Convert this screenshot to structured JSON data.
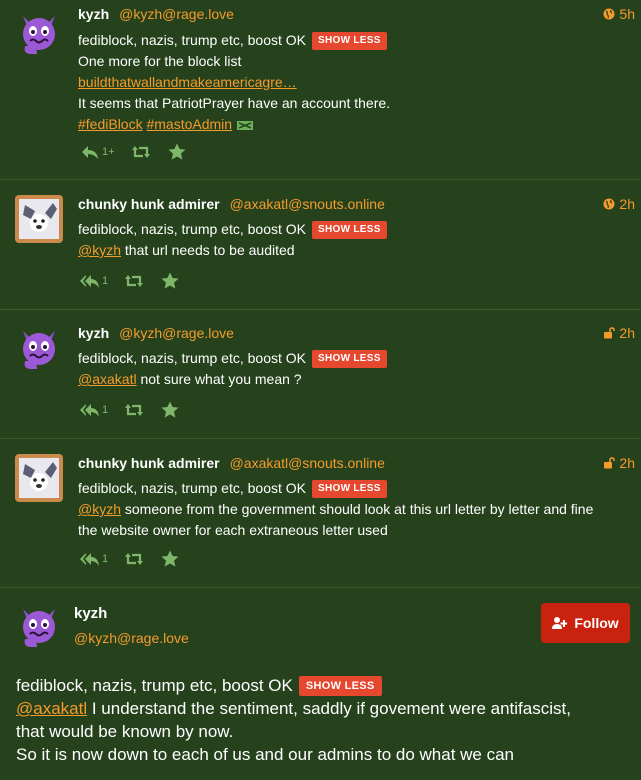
{
  "statuses": [
    {
      "display_name": "kyzh",
      "acct": "@kyzh@rage.love",
      "time": "5h",
      "visibility_icon": "globe-icon",
      "cw": "fediblock, nazis, trump etc, boost OK",
      "cw_button": "Show less",
      "lines": [
        "One more for the block list"
      ],
      "link": "buildthatwallandmakeamericagre…",
      "line2": "It seems that PatriotPrayer have an account there.",
      "hashtags": [
        "#fediBlock",
        "#mastoAdmin"
      ],
      "reply_count": "1+"
    },
    {
      "display_name": "chunky hunk admirer",
      "acct": "@axakatl@snouts.online",
      "time": "2h",
      "visibility_icon": "globe-icon",
      "cw": "fediblock, nazis, trump etc, boost OK",
      "cw_button": "Show less",
      "mention": "@kyzh",
      "text": " that url needs to be audited",
      "reply_count": "1"
    },
    {
      "display_name": "kyzh",
      "acct": "@kyzh@rage.love",
      "time": "2h",
      "visibility_icon": "unlock-icon",
      "cw": "fediblock, nazis, trump etc, boost OK",
      "cw_button": "Show less",
      "mention": "@axakatl",
      "text": " not sure what you mean ?",
      "reply_count": "1"
    },
    {
      "display_name": "chunky hunk admirer",
      "acct": "@axakatl@snouts.online",
      "time": "2h",
      "visibility_icon": "unlock-icon",
      "cw": "fediblock, nazis, trump etc, boost OK",
      "cw_button": "Show less",
      "mention": "@kyzh",
      "text": " someone from the government should look at this url letter by letter and fine",
      "text2": "the website owner for each extraneous letter used",
      "reply_count": "1"
    }
  ],
  "detail": {
    "display_name": "kyzh",
    "acct": "@kyzh@rage.love",
    "follow_label": "Follow",
    "cw": "fediblock, nazis, trump etc, boost OK",
    "cw_button": "Show less",
    "mention": "@axakatl",
    "text1": " I understand the sentiment, saddly if govement were antifascist,",
    "text2": "that would be known by now.",
    "text3": "So it is now down to each of us and our admins to do what we can"
  },
  "colors": {
    "background": "#25421d",
    "accent": "#f59b2c",
    "cw_button": "#e5482e",
    "follow_button": "#c9230f",
    "action_icons": "#7eb66a"
  }
}
